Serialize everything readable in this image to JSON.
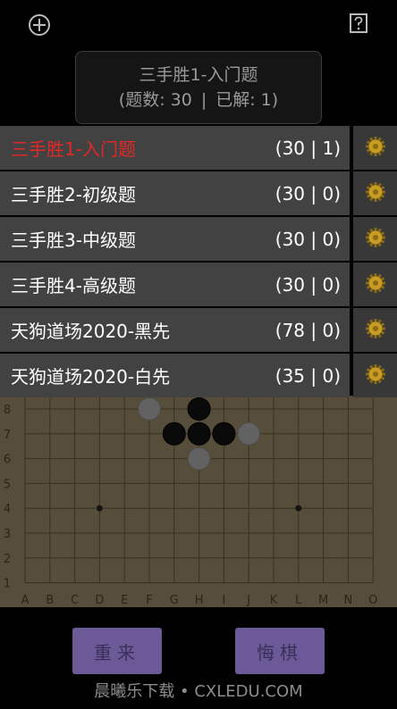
{
  "header": {
    "title": "三手胜1-入门题",
    "count_label": "(题数: 30",
    "divider": "|",
    "solved_label": "已解: 1)"
  },
  "problem_sets": [
    {
      "name": "三手胜1-入门题",
      "score": "(30 | 1)",
      "active": true
    },
    {
      "name": "三手胜2-初级题",
      "score": "(30 | 0)"
    },
    {
      "name": "三手胜3-中级题",
      "score": "(30 | 0)"
    },
    {
      "name": "三手胜4-高级题",
      "score": "(30 | 0)"
    },
    {
      "name": "天狗道场2020-黑先",
      "score": "(78 | 0)"
    },
    {
      "name": "天狗道场2020-白先",
      "score": "(35 | 0)"
    }
  ],
  "board": {
    "columns": [
      "A",
      "B",
      "C",
      "D",
      "E",
      "F",
      "G",
      "H",
      "I",
      "J",
      "K",
      "L",
      "M",
      "N",
      "O"
    ],
    "rows": [
      "8",
      "7",
      "6",
      "5",
      "4",
      "3",
      "2",
      "1"
    ],
    "stones": [
      {
        "col": "F",
        "row": 8,
        "color": "white"
      },
      {
        "col": "H",
        "row": 8,
        "color": "black"
      },
      {
        "col": "G",
        "row": 7,
        "color": "black"
      },
      {
        "col": "H",
        "row": 7,
        "color": "black"
      },
      {
        "col": "I",
        "row": 7,
        "color": "black"
      },
      {
        "col": "J",
        "row": 7,
        "color": "white"
      },
      {
        "col": "H",
        "row": 6,
        "color": "white"
      }
    ],
    "star_points": [
      {
        "col": "D",
        "row": 4
      },
      {
        "col": "L",
        "row": 4
      }
    ]
  },
  "buttons": {
    "restart": "重来",
    "undo": "悔棋"
  },
  "watermark": "晨曦乐下载 • CXLEDU.COM",
  "colors": {
    "active_text": "#e02828",
    "button": "#6c5a98",
    "board": "#d8c294"
  }
}
